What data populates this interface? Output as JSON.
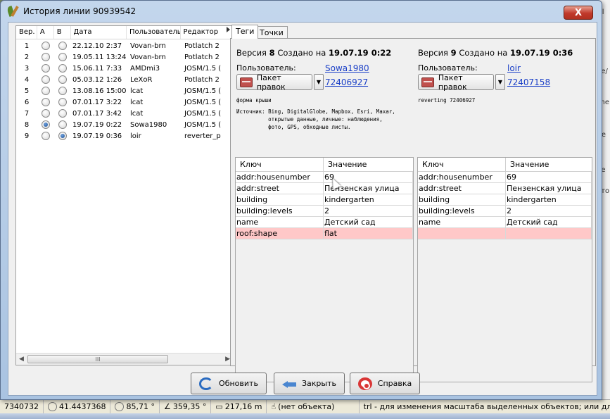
{
  "window": {
    "title": "История линии 90939542",
    "close_glyph": "X"
  },
  "history_table": {
    "columns": [
      "Вер.",
      "A",
      "B",
      "Дата",
      "Пользователь",
      "Редактор"
    ],
    "rows": [
      {
        "ver": "1",
        "a": false,
        "b": false,
        "date": "22.12.10 2:37",
        "user": "Vovan-brn",
        "editor": "Potlatch 2"
      },
      {
        "ver": "2",
        "a": false,
        "b": false,
        "date": "19.05.11 13:24",
        "user": "Vovan-brn",
        "editor": "Potlatch 2"
      },
      {
        "ver": "3",
        "a": false,
        "b": false,
        "date": "15.06.11 7:33",
        "user": "AMDmi3",
        "editor": "JOSM/1.5 ("
      },
      {
        "ver": "4",
        "a": false,
        "b": false,
        "date": "05.03.12 1:26",
        "user": "LeXoR",
        "editor": "Potlatch 2"
      },
      {
        "ver": "5",
        "a": false,
        "b": false,
        "date": "13.08.16 15:00",
        "user": "lcat",
        "editor": "JOSM/1.5 ("
      },
      {
        "ver": "6",
        "a": false,
        "b": false,
        "date": "07.01.17 3:22",
        "user": "lcat",
        "editor": "JOSM/1.5 ("
      },
      {
        "ver": "7",
        "a": false,
        "b": false,
        "date": "07.01.17 3:42",
        "user": "lcat",
        "editor": "JOSM/1.5 ("
      },
      {
        "ver": "8",
        "a": true,
        "b": false,
        "date": "19.07.19 0:22",
        "user": "Sowa1980",
        "editor": "JOSM/1.5 ("
      },
      {
        "ver": "9",
        "a": false,
        "b": true,
        "date": "19.07.19 0:36",
        "user": "loir",
        "editor": "reverter_p"
      }
    ],
    "scroll_thumb_glyph": "III"
  },
  "tabs": [
    {
      "label": "Теги",
      "active": true
    },
    {
      "label": "Точки",
      "active": false
    }
  ],
  "left_version": {
    "prefix": "Версия",
    "number": "8",
    "created": "Создано на",
    "date": "19.07.19 0:22",
    "user_label": "Пользователь:",
    "user": "Sowa1980",
    "changeset_button": "Пакет правок",
    "changeset_id": "72406927",
    "comment": "форма крыши",
    "source_lines": [
      "Источник: Bing, DigitalGlobe, Mapbox, Esri, Maxar,",
      "          открытые данные, личные: наблюдения,",
      "          фото, GPS, обходные листы."
    ]
  },
  "right_version": {
    "prefix": "Версия",
    "number": "9",
    "created": "Создано на",
    "date": "19.07.19 0:36",
    "user_label": "Пользователь:",
    "user": "loir",
    "changeset_button": "Пакет правок",
    "changeset_id": "72407158",
    "comment": "reverting 72406927"
  },
  "tag_table_headers": {
    "key": "Ключ",
    "value": "Значение"
  },
  "left_tags": [
    {
      "k": "addr:housenumber",
      "v": "69",
      "diff": false
    },
    {
      "k": "addr:street",
      "v": "Пензенская улица",
      "diff": false
    },
    {
      "k": "building",
      "v": "kindergarten",
      "diff": false
    },
    {
      "k": "building:levels",
      "v": "2",
      "diff": false
    },
    {
      "k": "name",
      "v": "Детский сад",
      "diff": false
    },
    {
      "k": "roof:shape",
      "v": "flat",
      "diff": true
    }
  ],
  "right_tags": [
    {
      "k": "addr:housenumber",
      "v": "69",
      "diff": false
    },
    {
      "k": "addr:street",
      "v": "Пензенская улица",
      "diff": false
    },
    {
      "k": "building",
      "v": "kindergarten",
      "diff": false
    },
    {
      "k": "building:levels",
      "v": "2",
      "diff": false
    },
    {
      "k": "name",
      "v": "Детский сад",
      "diff": false
    },
    {
      "k": "",
      "v": "",
      "diff": true
    }
  ],
  "buttons": {
    "refresh": "Обновить",
    "close": "Закрыть",
    "help": "Справка"
  },
  "status_bar": {
    "coord_y": "7340732",
    "lat": "41.4437368",
    "heading": "85,71 °",
    "angle": "359,35 °",
    "length": "217,16 m",
    "object": "(нет объекта)",
    "hint": "trl - для изменения масштаба выделенных объектов; или для и"
  },
  "background_right_panel": [
    "Gl",
    "c",
    "ре/",
    "c",
    "line",
    "c",
    "де",
    "c",
    "de",
    "ето"
  ]
}
